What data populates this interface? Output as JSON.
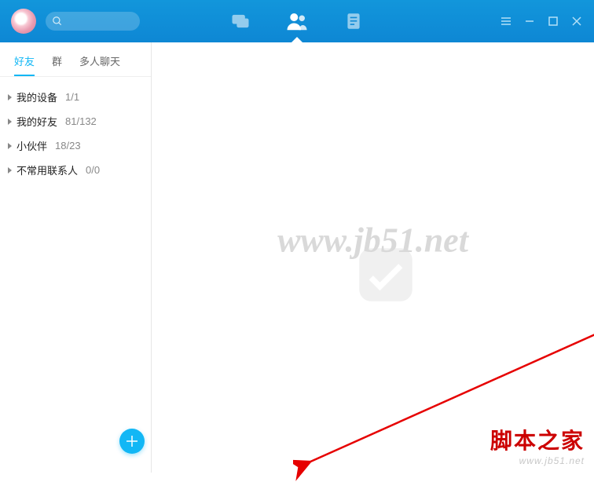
{
  "sub_tabs": {
    "friends": "好友",
    "groups": "群",
    "multi": "多人聊天"
  },
  "groups": [
    {
      "name": "我的设备",
      "count": "1/1"
    },
    {
      "name": "我的好友",
      "count": "81/132"
    },
    {
      "name": "小伙伴",
      "count": "18/23"
    },
    {
      "name": "不常用联系人",
      "count": "0/0"
    }
  ],
  "watermark": "www.jb51.net",
  "brand": {
    "cn": "脚本之家",
    "url": "www.jb51.net"
  }
}
